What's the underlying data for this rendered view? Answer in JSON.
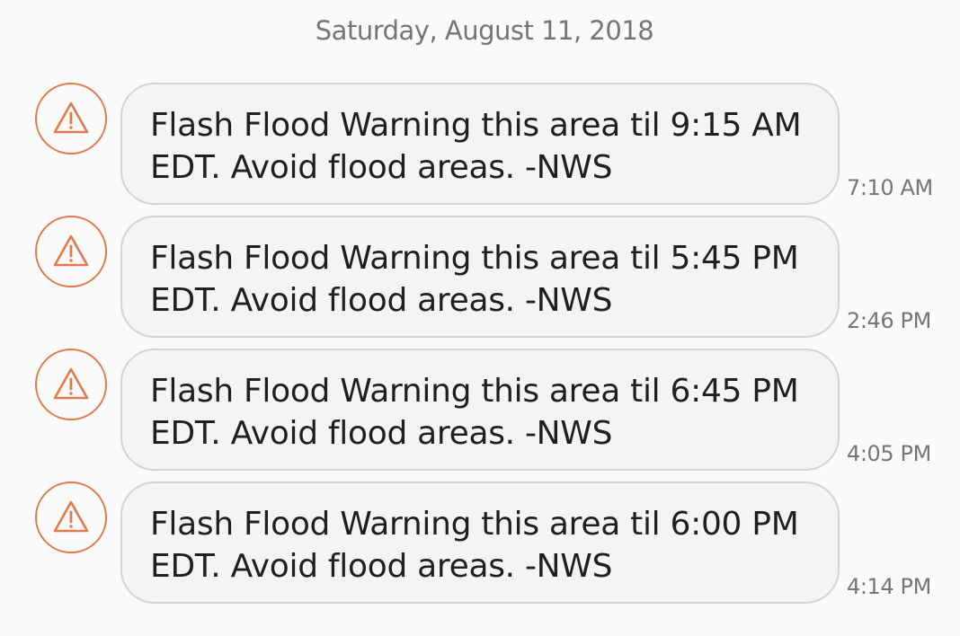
{
  "thread": {
    "date": "Saturday, August 11, 2018",
    "accent_color": "#e07a4d",
    "messages": [
      {
        "icon": "warning-icon",
        "line1": "Flash Flood Warning this area til 9:15 AM",
        "line2": "EDT. Avoid flood areas. -NWS",
        "time": "7:10 AM"
      },
      {
        "icon": "warning-icon",
        "line1": "Flash Flood Warning this area til 5:45 PM",
        "line2": "EDT. Avoid flood areas. -NWS",
        "time": "2:46 PM"
      },
      {
        "icon": "warning-icon",
        "line1": "Flash Flood Warning this area til 6:45 PM",
        "line2": "EDT. Avoid flood areas. -NWS",
        "time": "4:05 PM"
      },
      {
        "icon": "warning-icon",
        "line1": "Flash Flood Warning this area til 6:00 PM",
        "line2": "EDT. Avoid flood areas. -NWS",
        "time": "4:14 PM"
      }
    ]
  }
}
